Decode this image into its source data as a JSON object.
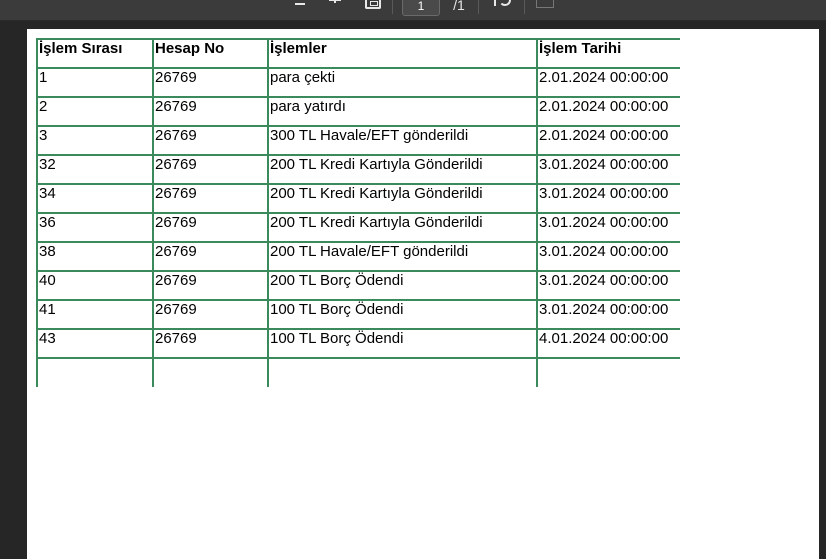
{
  "toolbar": {
    "page_number": "1",
    "page_total": "/1"
  },
  "table": {
    "headers": [
      "İşlem Sırası",
      "Hesap No",
      "İşlemler",
      "İşlem Tarihi"
    ],
    "rows": [
      [
        "1",
        "26769",
        "para çekti",
        "2.01.2024 00:00:00"
      ],
      [
        "2",
        "26769",
        "para yatırdı",
        "2.01.2024 00:00:00"
      ],
      [
        "3",
        "26769",
        "300 TL Havale/EFT gönderildi",
        "2.01.2024 00:00:00"
      ],
      [
        "32",
        "26769",
        "200 TL Kredi Kartıyla Gönderildi",
        "3.01.2024 00:00:00"
      ],
      [
        "34",
        "26769",
        "200 TL Kredi Kartıyla Gönderildi",
        "3.01.2024 00:00:00"
      ],
      [
        "36",
        "26769",
        "200 TL Kredi Kartıyla Gönderildi",
        "3.01.2024 00:00:00"
      ],
      [
        "38",
        "26769",
        "200 TL Havale/EFT gönderildi",
        "3.01.2024 00:00:00"
      ],
      [
        "40",
        "26769",
        "200 TL Borç Ödendi",
        "3.01.2024 00:00:00"
      ],
      [
        "41",
        "26769",
        "100 TL Borç Ödendi",
        "3.01.2024 00:00:00"
      ],
      [
        "43",
        "26769",
        "100 TL Borç Ödendi",
        "4.01.2024 00:00:00"
      ]
    ]
  },
  "colors": {
    "grid_border": "#3a8a5c",
    "viewer_background": "#262626"
  }
}
